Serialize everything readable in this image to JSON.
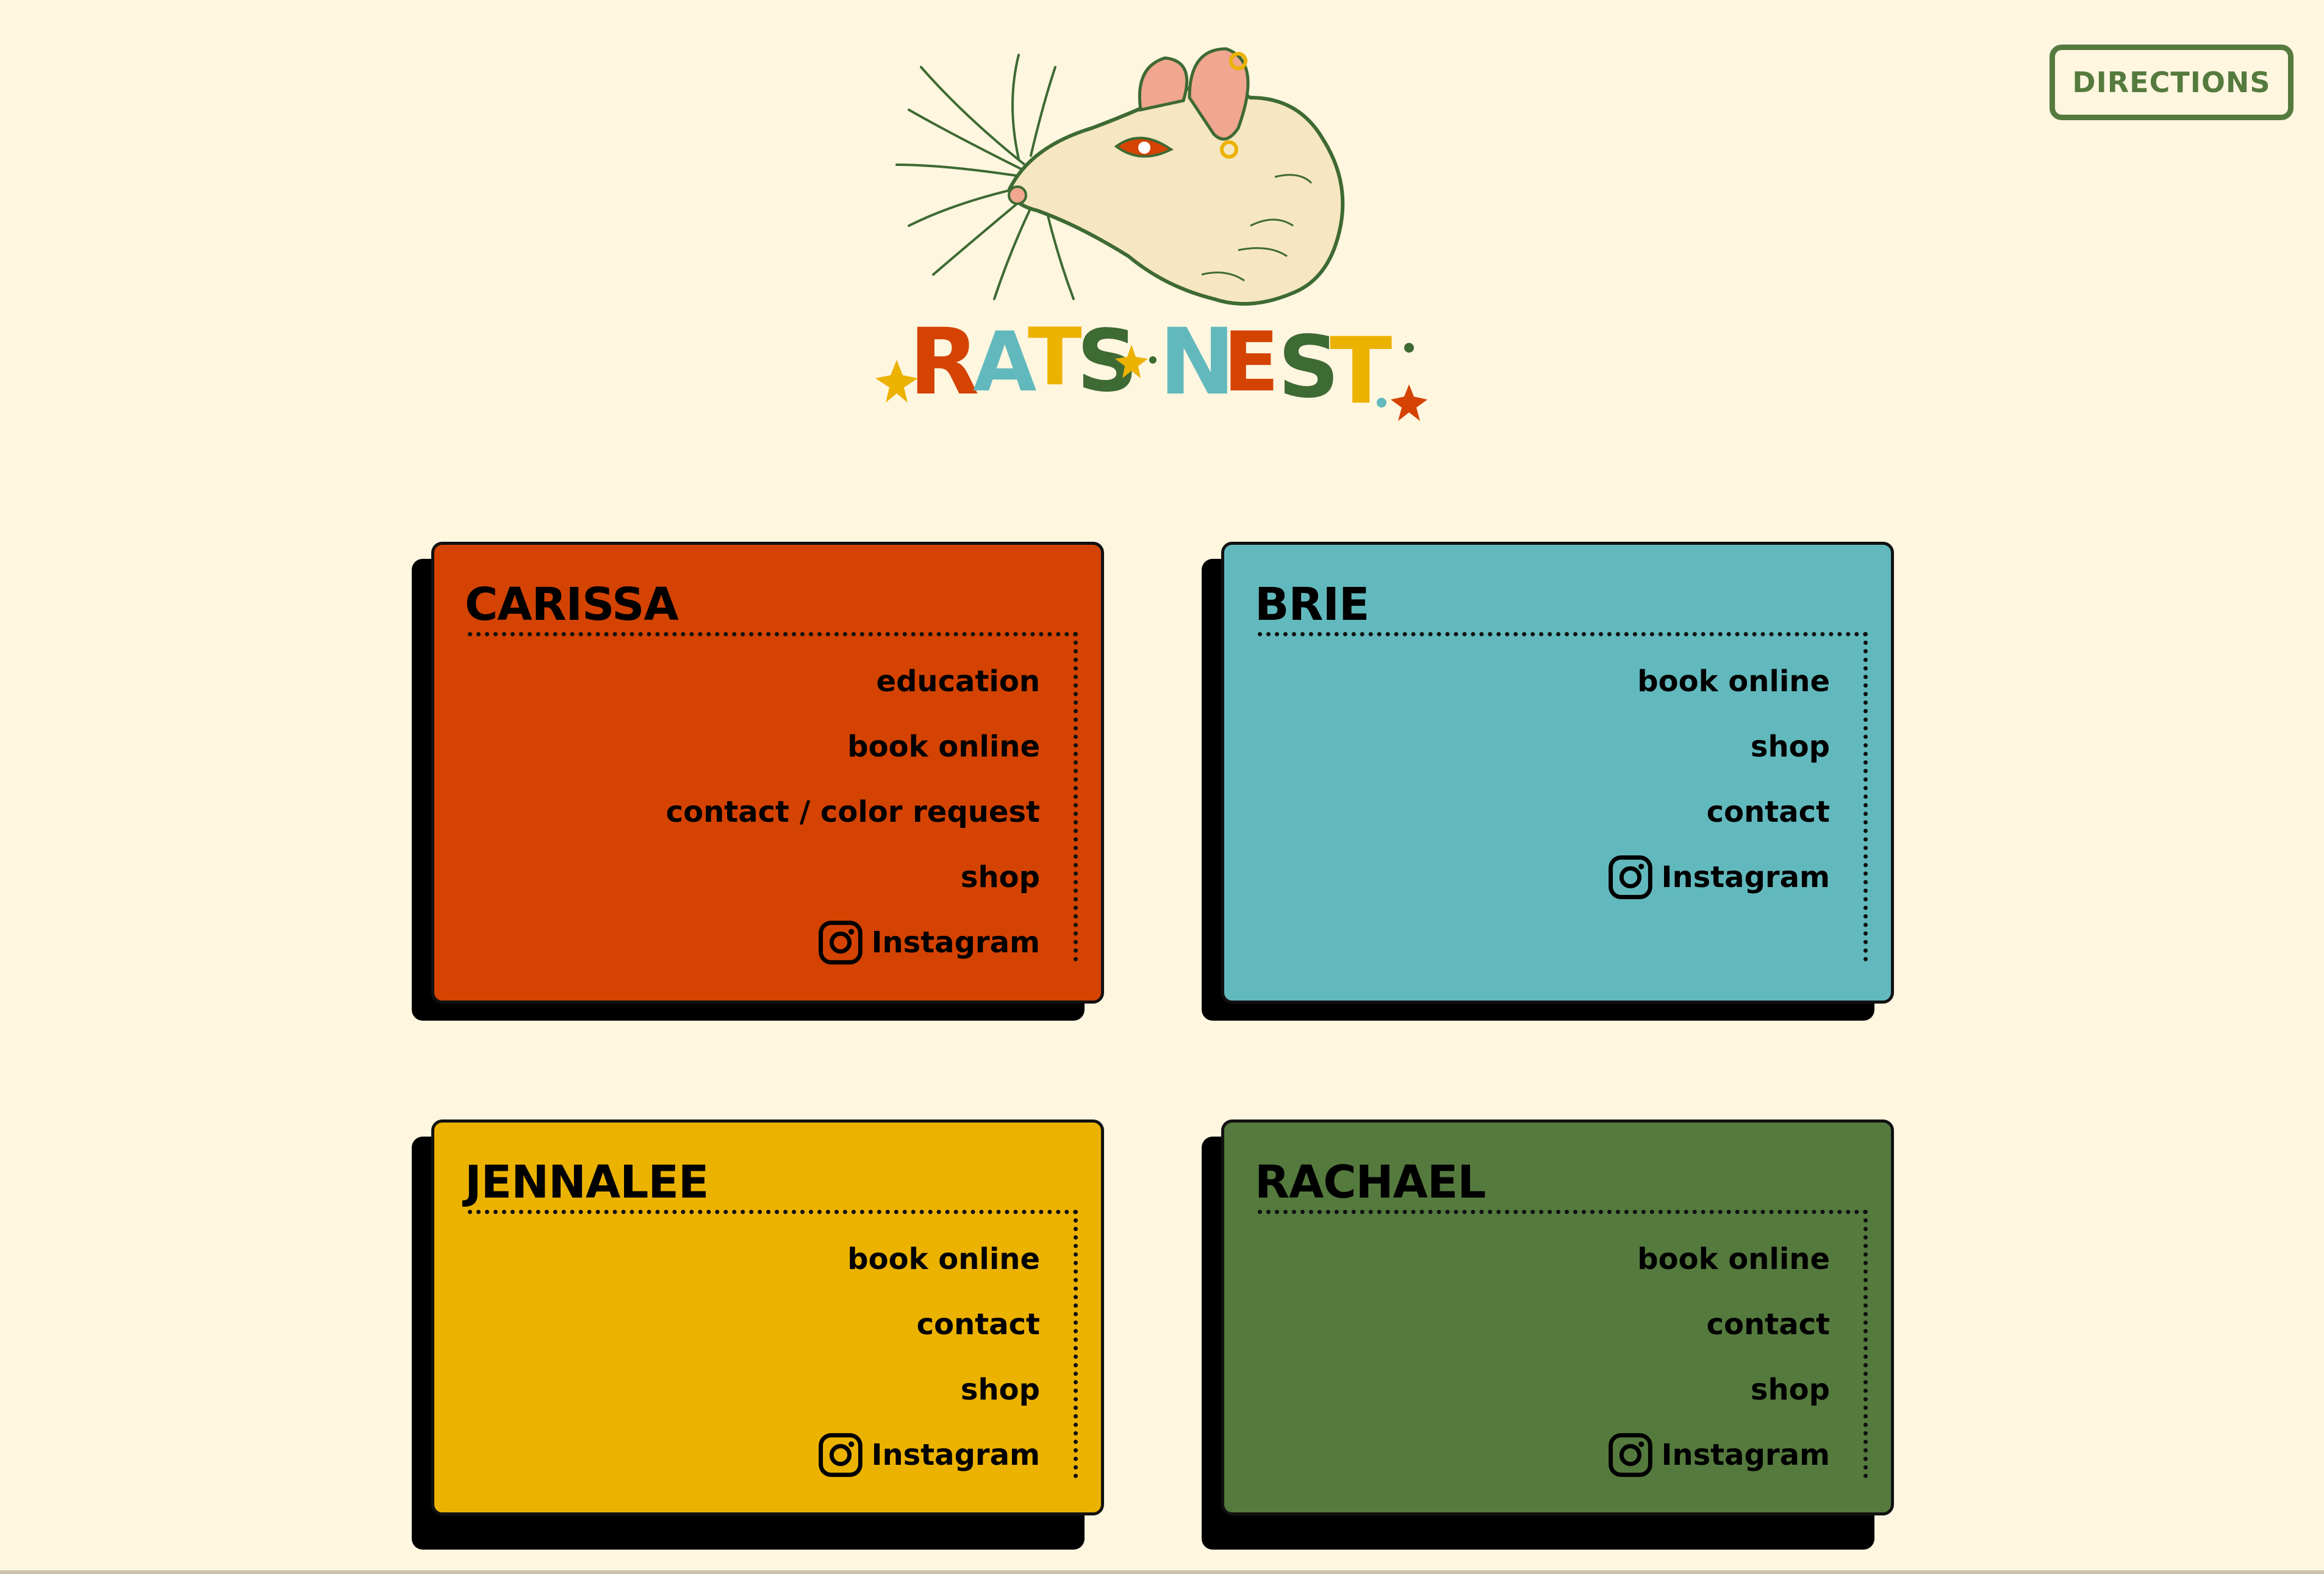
{
  "header": {
    "directions_label": "DIRECTIONS",
    "logo_text": "RATS NEST"
  },
  "colors": {
    "background": "#fff6e0",
    "accent_green": "#557a3e",
    "card_orange": "#d44302",
    "card_teal": "#62b9bd",
    "card_yellow": "#ecb200",
    "card_green": "#557a3e"
  },
  "cards": [
    {
      "name": "CARISSA",
      "color": "#d44302",
      "links": [
        "education",
        "book online",
        "contact / color request",
        "shop"
      ],
      "instagram_label": "Instagram"
    },
    {
      "name": "BRIE",
      "color": "#62b9bd",
      "links": [
        "book online",
        "shop",
        "contact"
      ],
      "instagram_label": "Instagram"
    },
    {
      "name": "JENNALEE",
      "color": "#ecb200",
      "links": [
        "book online",
        "contact",
        "shop"
      ],
      "instagram_label": "Instagram"
    },
    {
      "name": "RACHAEL",
      "color": "#557a3e",
      "links": [
        "book online",
        "contact",
        "shop"
      ],
      "instagram_label": "Instagram"
    }
  ],
  "icons": {
    "instagram": "instagram-icon",
    "logo": "rat-head-logo"
  }
}
